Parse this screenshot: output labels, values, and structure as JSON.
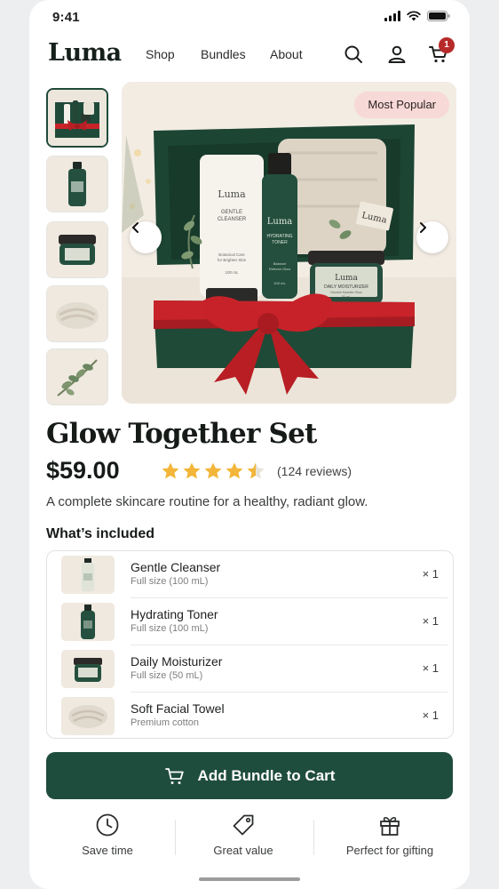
{
  "status_bar": {
    "time": "9:41"
  },
  "nav": {
    "logo": "Luma",
    "links": [
      "Shop",
      "Bundles",
      "About"
    ],
    "icons": [
      "search-icon",
      "account-icon",
      "cart-icon"
    ],
    "cart_count": "1"
  },
  "gallery": {
    "badge": "Most Popular",
    "thumbnails": [
      "gift-box",
      "cleanser-bottle",
      "moisturizer-jar",
      "rolled-towel",
      "eucalyptus-sprig"
    ],
    "hero_labels": {
      "cleanser_brand": "Luma",
      "cleanser_name_1": "GENTLE",
      "cleanser_name_2": "CLEANSER",
      "cleanser_desc_1": "Botanical Care",
      "cleanser_desc_2": "for Brighter Skin",
      "cleanser_size": "100 mL",
      "toner_brand": "Luma",
      "toner_name_1": "HYDRATING",
      "toner_name_2": "TONER",
      "toner_desc_1": "Balance",
      "toner_desc_2": "Refresh Glow",
      "toner_size": "100 mL",
      "jar_brand": "Luma",
      "jar_name": "DAILY MOISTURIZER",
      "jar_desc": "Nourish Hydrate Glow",
      "jar_size": "50 mL",
      "tag_brand": "Luma"
    }
  },
  "product": {
    "title": "Glow Together Set",
    "price": "$59.00",
    "rating": 4.5,
    "reviews": "(124 reviews)",
    "description": "A complete skincare routine for a healthy, radiant glow."
  },
  "included": {
    "heading": "What’s included",
    "items": [
      {
        "name": "Gentle Cleanser",
        "detail": "Full size (100 mL)",
        "qty": "× 1"
      },
      {
        "name": "Hydrating Toner",
        "detail": "Full size (100 mL)",
        "qty": "× 1"
      },
      {
        "name": "Daily Moisturizer",
        "detail": "Full size (50 mL)",
        "qty": "× 1"
      },
      {
        "name": "Soft Facial Towel",
        "detail": "Premium cotton",
        "qty": "× 1"
      }
    ]
  },
  "cta": {
    "label": "Add Bundle to Cart"
  },
  "features": [
    {
      "icon": "clock-icon",
      "label": "Save time"
    },
    {
      "icon": "tag-icon",
      "label": "Great value"
    },
    {
      "icon": "gift-icon",
      "label": "Perfect for gifting"
    }
  ],
  "colors": {
    "brand_green": "#1f4d3d",
    "badge_pink": "#f7d9d7",
    "star_gold": "#f3b63a",
    "cart_badge": "#b72a2a",
    "ribbon_red": "#c8232a"
  }
}
